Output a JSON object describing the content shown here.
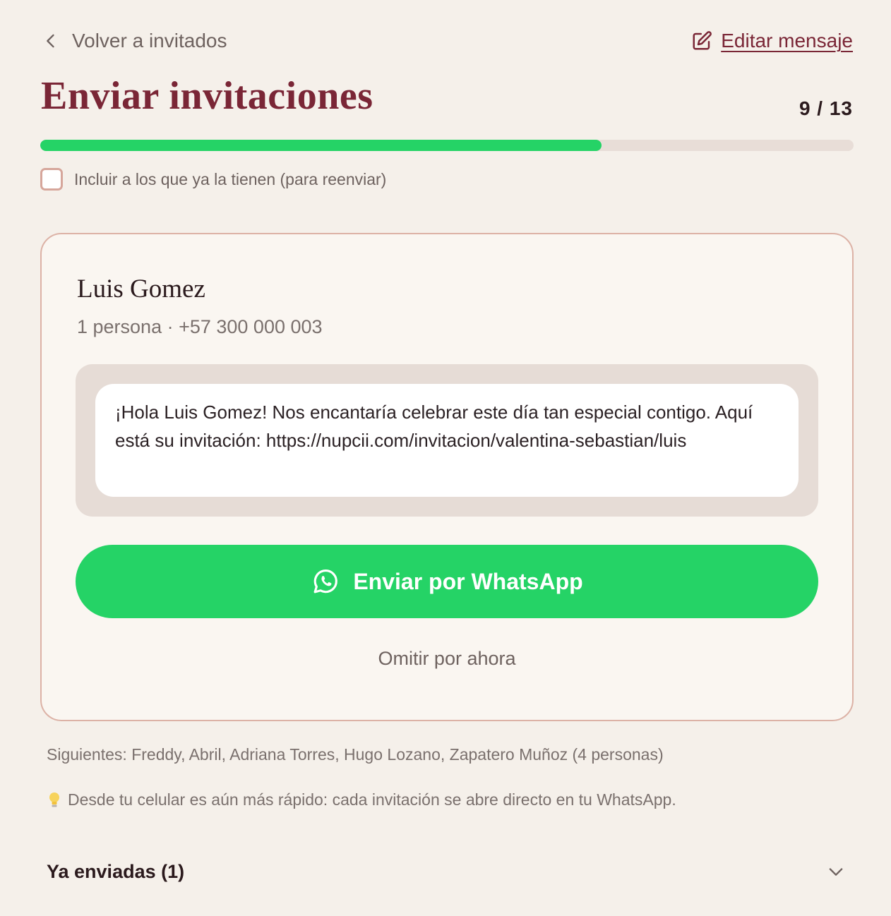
{
  "nav": {
    "back_label": "Volver a invitados",
    "edit_label": "Editar mensaje"
  },
  "header": {
    "title": "Enviar invitaciones",
    "counter": "9 / 13",
    "progress_fraction": 0.69
  },
  "options": {
    "resend_label": "Incluir a los que ya la tienen (para reenviar)",
    "resend_checked": false
  },
  "guest": {
    "name": "Luis Gomez",
    "meta": "1 persona · +57 300 000 003",
    "message": "¡Hola Luis Gomez! Nos encantaría celebrar este día tan especial contigo. Aquí está su invitación: https://nupcii.com/invitacion/valentina-sebastian/luis"
  },
  "actions": {
    "whatsapp_label": "Enviar por WhatsApp",
    "skip_label": "Omitir por ahora"
  },
  "upcoming": {
    "text": "Siguientes: Freddy, Abril, Adriana Torres, Hugo Lozano, Zapatero Muñoz (4 personas)"
  },
  "tip": {
    "icon": "lightbulb-icon",
    "text": "Desde tu celular es aún más rápido: cada invitación se abre directo en tu WhatsApp."
  },
  "sent_section": {
    "title": "Ya enviadas (1)"
  },
  "colors": {
    "background": "#f5f0ea",
    "brand": "#7a2636",
    "whatsapp": "#25d366",
    "card_border": "#dcb2a6"
  }
}
